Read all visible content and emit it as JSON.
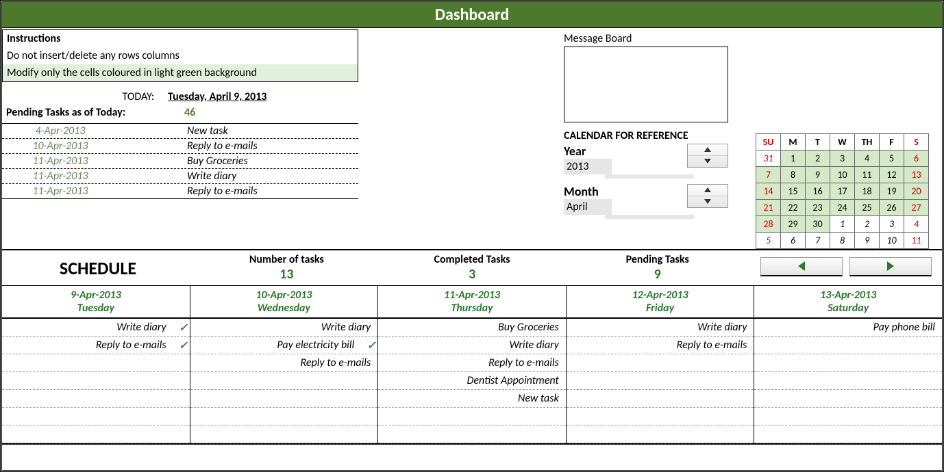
{
  "header": {
    "title": "Dashboard"
  },
  "instructions": {
    "title": "Instructions",
    "line1": "Do not insert/delete any rows columns",
    "line2": "Modify only the cells coloured in light green background"
  },
  "today": {
    "label": "TODAY:",
    "value": "Tuesday, April 9, 2013"
  },
  "pending": {
    "label": "Pending Tasks as of Today:",
    "value": "46"
  },
  "task_list": [
    {
      "date": "4-Apr-2013",
      "desc": "New task"
    },
    {
      "date": "10-Apr-2013",
      "desc": "Reply to e-mails"
    },
    {
      "date": "11-Apr-2013",
      "desc": "Buy Groceries"
    },
    {
      "date": "11-Apr-2013",
      "desc": "Write diary"
    },
    {
      "date": "11-Apr-2013",
      "desc": "Reply to e-mails"
    }
  ],
  "message_board": {
    "label": "Message Board"
  },
  "calendar_ref": {
    "title": "CALENDAR FOR REFERENCE",
    "year_label": "Year",
    "year_value": "2013",
    "month_label": "Month",
    "month_value": "April",
    "dow": [
      "SU",
      "M",
      "T",
      "W",
      "TH",
      "F",
      "S"
    ],
    "weeks": [
      [
        {
          "d": "31",
          "in": false,
          "we": true
        },
        {
          "d": "1",
          "in": true
        },
        {
          "d": "2",
          "in": true
        },
        {
          "d": "3",
          "in": true
        },
        {
          "d": "4",
          "in": true
        },
        {
          "d": "5",
          "in": true
        },
        {
          "d": "6",
          "in": true,
          "we": true
        }
      ],
      [
        {
          "d": "7",
          "in": true,
          "we": true
        },
        {
          "d": "8",
          "in": true
        },
        {
          "d": "9",
          "in": true
        },
        {
          "d": "10",
          "in": true
        },
        {
          "d": "11",
          "in": true
        },
        {
          "d": "12",
          "in": true
        },
        {
          "d": "13",
          "in": true,
          "we": true
        }
      ],
      [
        {
          "d": "14",
          "in": true,
          "we": true
        },
        {
          "d": "15",
          "in": true
        },
        {
          "d": "16",
          "in": true
        },
        {
          "d": "17",
          "in": true
        },
        {
          "d": "18",
          "in": true
        },
        {
          "d": "19",
          "in": true
        },
        {
          "d": "20",
          "in": true,
          "we": true
        }
      ],
      [
        {
          "d": "21",
          "in": true,
          "we": true
        },
        {
          "d": "22",
          "in": true
        },
        {
          "d": "23",
          "in": true
        },
        {
          "d": "24",
          "in": true
        },
        {
          "d": "25",
          "in": true
        },
        {
          "d": "26",
          "in": true
        },
        {
          "d": "27",
          "in": true,
          "we": true
        }
      ],
      [
        {
          "d": "28",
          "in": true,
          "we": true
        },
        {
          "d": "29",
          "in": true
        },
        {
          "d": "30",
          "in": true
        },
        {
          "d": "1",
          "in": false
        },
        {
          "d": "2",
          "in": false
        },
        {
          "d": "3",
          "in": false
        },
        {
          "d": "4",
          "in": false,
          "we": true
        }
      ],
      [
        {
          "d": "5",
          "in": false,
          "we": true
        },
        {
          "d": "6",
          "in": false
        },
        {
          "d": "7",
          "in": false
        },
        {
          "d": "8",
          "in": false
        },
        {
          "d": "9",
          "in": false
        },
        {
          "d": "10",
          "in": false
        },
        {
          "d": "11",
          "in": false,
          "we": true
        }
      ]
    ]
  },
  "stats": {
    "schedule_title": "SCHEDULE",
    "num_tasks_label": "Number of tasks",
    "num_tasks_value": "13",
    "completed_label": "Completed Tasks",
    "completed_value": "3",
    "pending_label": "Pending Tasks",
    "pending_value": "9"
  },
  "schedule": {
    "days": [
      {
        "date": "9-Apr-2013",
        "dow": "Tuesday",
        "tasks": [
          {
            "t": "Write diary",
            "done": true
          },
          {
            "t": "Reply to e-mails",
            "done": true
          }
        ]
      },
      {
        "date": "10-Apr-2013",
        "dow": "Wednesday",
        "tasks": [
          {
            "t": "Write diary",
            "done": false
          },
          {
            "t": "Pay electricity bill",
            "done": true
          },
          {
            "t": "Reply to e-mails",
            "done": false
          }
        ]
      },
      {
        "date": "11-Apr-2013",
        "dow": "Thursday",
        "tasks": [
          {
            "t": "Buy Groceries",
            "done": false
          },
          {
            "t": "Write diary",
            "done": false
          },
          {
            "t": "Reply to e-mails",
            "done": false
          },
          {
            "t": "Dentist Appointment",
            "done": false
          },
          {
            "t": "New task",
            "done": false
          }
        ]
      },
      {
        "date": "12-Apr-2013",
        "dow": "Friday",
        "tasks": [
          {
            "t": "Write diary",
            "done": false
          },
          {
            "t": "Reply to e-mails",
            "done": false
          }
        ]
      },
      {
        "date": "13-Apr-2013",
        "dow": "Saturday",
        "tasks": [
          {
            "t": "Pay phone bill",
            "done": false
          }
        ]
      }
    ],
    "slots_per_day": 7
  }
}
